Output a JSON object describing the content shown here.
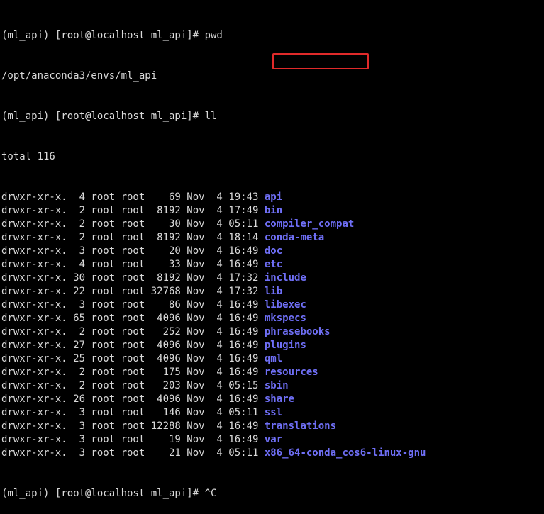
{
  "prompt": "(ml_api) [root@localhost ml_api]# ",
  "commands": {
    "pwd": "pwd",
    "ll": "ll",
    "last": "^C"
  },
  "pwd_output": "/opt/anaconda3/envs/ml_api",
  "total_line": "total 116",
  "entries": [
    {
      "meta": "drwxr-xr-x.  4 root root    69 Nov  4 19:43 ",
      "name": "api"
    },
    {
      "meta": "drwxr-xr-x.  2 root root  8192 Nov  4 17:49 ",
      "name": "bin"
    },
    {
      "meta": "drwxr-xr-x.  2 root root    30 Nov  4 05:11 ",
      "name": "compiler_compat"
    },
    {
      "meta": "drwxr-xr-x.  2 root root  8192 Nov  4 18:14 ",
      "name": "conda-meta"
    },
    {
      "meta": "drwxr-xr-x.  3 root root    20 Nov  4 16:49 ",
      "name": "doc"
    },
    {
      "meta": "drwxr-xr-x.  4 root root    33 Nov  4 16:49 ",
      "name": "etc"
    },
    {
      "meta": "drwxr-xr-x. 30 root root  8192 Nov  4 17:32 ",
      "name": "include"
    },
    {
      "meta": "drwxr-xr-x. 22 root root 32768 Nov  4 17:32 ",
      "name": "lib"
    },
    {
      "meta": "drwxr-xr-x.  3 root root    86 Nov  4 16:49 ",
      "name": "libexec"
    },
    {
      "meta": "drwxr-xr-x. 65 root root  4096 Nov  4 16:49 ",
      "name": "mkspecs"
    },
    {
      "meta": "drwxr-xr-x.  2 root root   252 Nov  4 16:49 ",
      "name": "phrasebooks"
    },
    {
      "meta": "drwxr-xr-x. 27 root root  4096 Nov  4 16:49 ",
      "name": "plugins"
    },
    {
      "meta": "drwxr-xr-x. 25 root root  4096 Nov  4 16:49 ",
      "name": "qml"
    },
    {
      "meta": "drwxr-xr-x.  2 root root   175 Nov  4 16:49 ",
      "name": "resources"
    },
    {
      "meta": "drwxr-xr-x.  2 root root   203 Nov  4 05:15 ",
      "name": "sbin"
    },
    {
      "meta": "drwxr-xr-x. 26 root root  4096 Nov  4 16:49 ",
      "name": "share"
    },
    {
      "meta": "drwxr-xr-x.  3 root root   146 Nov  4 05:11 ",
      "name": "ssl"
    },
    {
      "meta": "drwxr-xr-x.  3 root root 12288 Nov  4 16:49 ",
      "name": "translations"
    },
    {
      "meta": "drwxr-xr-x.  3 root root    19 Nov  4 16:49 ",
      "name": "var"
    },
    {
      "meta": "drwxr-xr-x.  3 root root    21 Nov  4 05:11 ",
      "name": "x86_64-conda_cos6-linux-gnu"
    }
  ],
  "colors": {
    "background": "#000000",
    "text": "#d9d9d9",
    "directory": "#6f6ff6",
    "highlight": "#e02a2a"
  }
}
